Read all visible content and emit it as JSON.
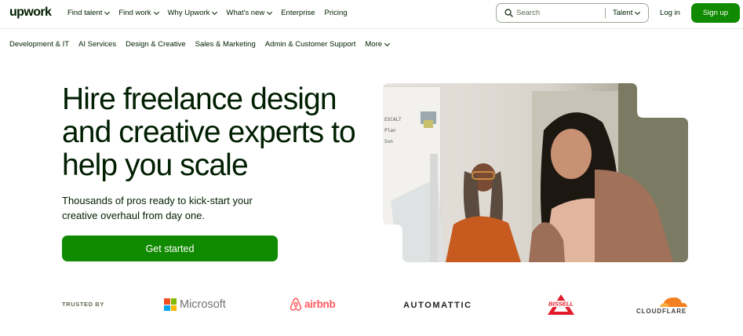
{
  "header": {
    "logo": "upwork",
    "nav": [
      {
        "label": "Find talent",
        "dropdown": true
      },
      {
        "label": "Find work",
        "dropdown": true
      },
      {
        "label": "Why Upwork",
        "dropdown": true
      },
      {
        "label": "What's new",
        "dropdown": true
      },
      {
        "label": "Enterprise",
        "dropdown": false
      },
      {
        "label": "Pricing",
        "dropdown": false
      }
    ],
    "search": {
      "placeholder": "Search",
      "scope": "Talent"
    },
    "login": "Log in",
    "signup": "Sign up"
  },
  "subnav": {
    "items": [
      "Development & IT",
      "AI Services",
      "Design & Creative",
      "Sales & Marketing",
      "Admin & Customer Support"
    ],
    "more": "More"
  },
  "hero": {
    "title": "Hire freelance design and creative experts to help you scale",
    "subtitle": "Thousands of pros ready to kick-start your creative overhaul from day one.",
    "cta": "Get started"
  },
  "trusted": {
    "label": "TRUSTED BY",
    "logos": {
      "microsoft": "Microsoft",
      "airbnb": "airbnb",
      "automattic": "AUTOMATTIC",
      "bissell": "BISSELL",
      "cloudflare": "CLOUDFLARE"
    }
  },
  "colors": {
    "brand_green": "#108a00",
    "text": "#001e00",
    "muted": "#5e6d55",
    "airbnb": "#ff5a5f",
    "cloudflare": "#f38020"
  }
}
